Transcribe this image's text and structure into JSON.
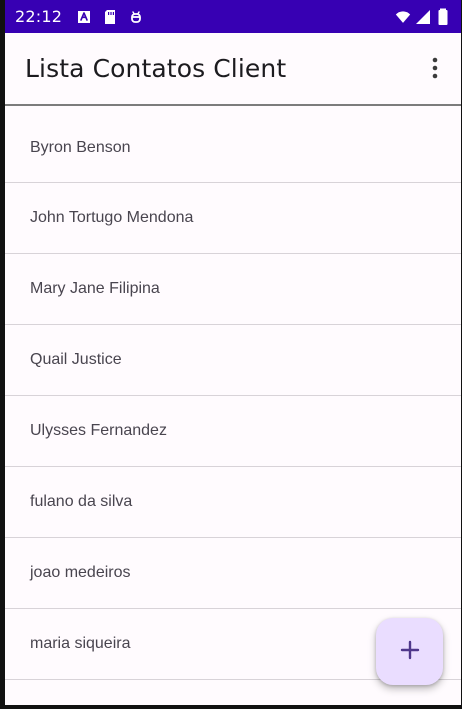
{
  "status_bar": {
    "time": "22:12",
    "icons": [
      "a-box-icon",
      "sd-card-icon",
      "android-icon",
      "wifi-icon",
      "signal-icon",
      "battery-icon"
    ]
  },
  "app_bar": {
    "title": "Lista Contatos Client",
    "overflow_icon": "more-vertical-icon"
  },
  "contacts": [
    "Byron Benson",
    "John Tortugo Mendona",
    "Mary Jane Filipina",
    "Quail Justice",
    "Ulysses Fernandez",
    "fulano da silva",
    "joao medeiros",
    "maria siqueira"
  ],
  "fab": {
    "icon": "plus-icon"
  },
  "colors": {
    "status_bar": "#3700b3",
    "surface": "#fffbfe",
    "fab": "#eaddff",
    "text": "#49454f"
  }
}
